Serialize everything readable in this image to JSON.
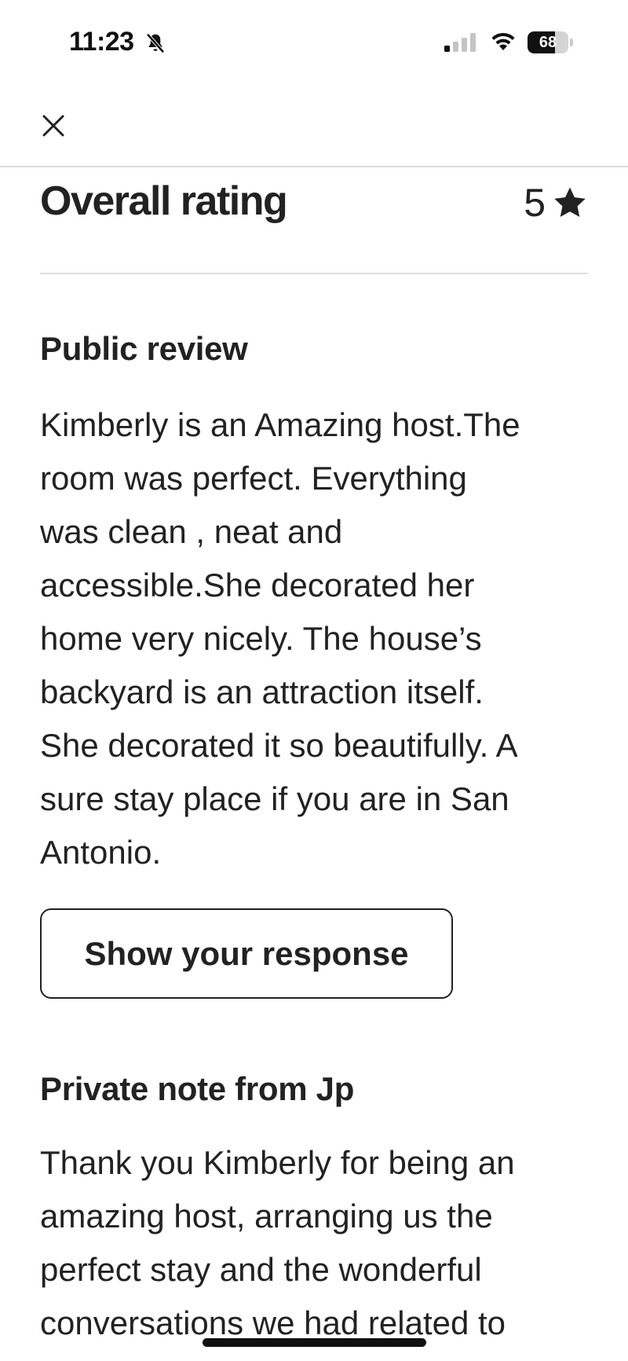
{
  "status_bar": {
    "time": "11:23",
    "battery_level": "68",
    "battery_fraction": 0.68,
    "icons": [
      "bell-muted-icon",
      "cellular-signal-icon",
      "wifi-icon",
      "battery-icon"
    ]
  },
  "header": {
    "close_icon": "close-icon"
  },
  "overall_rating": {
    "label": "Overall rating",
    "value": "5",
    "icon": "star-icon"
  },
  "public_review": {
    "title": "Public review",
    "text": "Kimberly is an Amazing host.The\nroom was perfect. Everything\nwas clean , neat and\naccessible.She decorated her\nhome very nicely. The house’s\nbackyard is an attraction itself.\nShe decorated it so beautifully. A\nsure stay place if you are in San\nAntonio.",
    "button_label": "Show your response"
  },
  "private_note": {
    "title": "Private note from Jp",
    "text": "Thank you Kimberly for being an\namazing host, arranging us the\nperfect stay and the wonderful\nconversations we had related to"
  },
  "colors": {
    "text": "#222222",
    "divider": "#dddddd",
    "background": "#ffffff"
  }
}
